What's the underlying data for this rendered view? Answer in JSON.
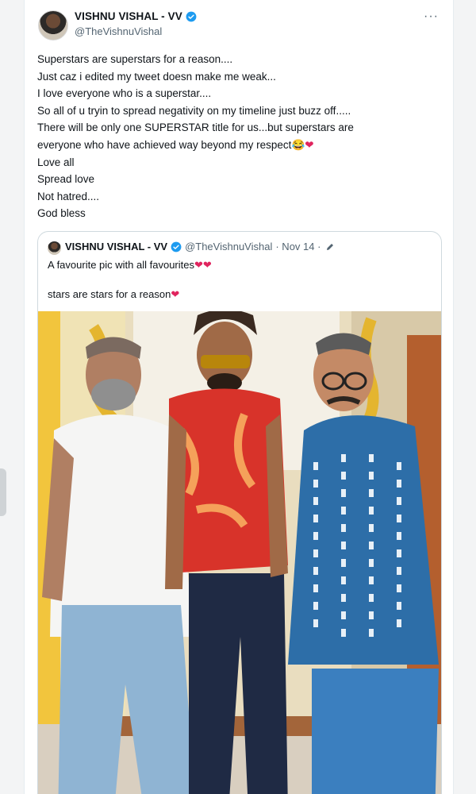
{
  "colors": {
    "accent": "#1d9bf0",
    "heart": "#e0245e",
    "muted": "#536471"
  },
  "tweet": {
    "display_name": "VISHNU VISHAL - VV",
    "handle": "@TheVishnuVishal",
    "more_icon": "···",
    "lines": [
      "Superstars are superstars for a reason....",
      "Just caz i edited my tweet doesn make me weak...",
      "I love everyone who is a superstar....",
      "So all of u tryin to spread negativity on my timeline just buzz off.....",
      "There will be only one SUPERSTAR title for us...but superstars are",
      "everyone who have achieved way beyond my respect",
      "Love all",
      "Spread love",
      "Not hatred....",
      "God bless"
    ],
    "line6_emoji": "😂",
    "line6_heart": "❤"
  },
  "quote": {
    "display_name": "VISHNU VISHAL - VV",
    "handle": "@TheVishnuVishal",
    "date": "· Nov 14 ·",
    "text_line1": "A favourite pic with all favourites",
    "text_line1_hearts": "❤❤",
    "text_line2": "stars are stars for a reason",
    "text_line2_heart": "❤"
  }
}
